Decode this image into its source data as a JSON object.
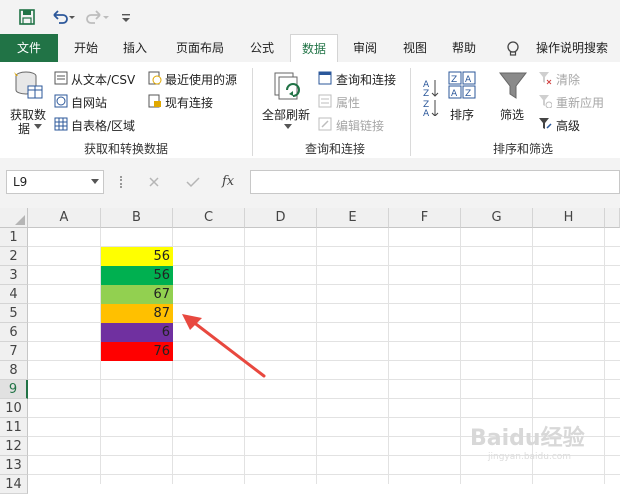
{
  "qat": {
    "icons": [
      "save-icon",
      "undo-icon",
      "redo-icon",
      "customize-qat-icon"
    ]
  },
  "tabs": [
    {
      "label": "文件"
    },
    {
      "label": "开始"
    },
    {
      "label": "插入"
    },
    {
      "label": "页面布局"
    },
    {
      "label": "公式"
    },
    {
      "label": "数据"
    },
    {
      "label": "审阅"
    },
    {
      "label": "视图"
    },
    {
      "label": "帮助"
    }
  ],
  "tell_me": "操作说明搜索",
  "ribbon": {
    "get_data": "获取数",
    "get_data2": "据",
    "from_text": "从文本/CSV",
    "from_web": "自网站",
    "from_table": "自表格/区域",
    "recent_sources": "最近使用的源",
    "existing_connections": "现有连接",
    "group1": "获取和转换数据",
    "refresh_all": "全部刷新",
    "queries_connections": "查询和连接",
    "properties": "属性",
    "edit_links": "编辑链接",
    "group2": "查询和连接",
    "sort": "排序",
    "filter": "筛选",
    "clear": "清除",
    "reapply": "重新应用",
    "advanced": "高级",
    "group3": "排序和筛选"
  },
  "formula_bar": {
    "name_box": "L9",
    "fx": "fx",
    "formula": ""
  },
  "columns": [
    "A",
    "B",
    "C",
    "D",
    "E",
    "F",
    "G",
    "H"
  ],
  "rows": [
    "1",
    "2",
    "3",
    "4",
    "5",
    "6",
    "7",
    "8",
    "9",
    "10",
    "11",
    "12",
    "13",
    "14"
  ],
  "selected_row": "9",
  "cells": [
    {
      "ref": "B2",
      "value": "56",
      "fill": "#ffff00"
    },
    {
      "ref": "B3",
      "value": "56",
      "fill": "#00b050"
    },
    {
      "ref": "B4",
      "value": "67",
      "fill": "#92d050"
    },
    {
      "ref": "B5",
      "value": "87",
      "fill": "#ffc000"
    },
    {
      "ref": "B6",
      "value": "6",
      "fill": "#7030a0"
    },
    {
      "ref": "B7",
      "value": "76",
      "fill": "#ff0000"
    }
  ],
  "colors": {
    "accent": "#217346",
    "arrow": "#e8483f"
  },
  "watermark": "Baidu经验",
  "watermark_url": "jingyan.baidu.com"
}
